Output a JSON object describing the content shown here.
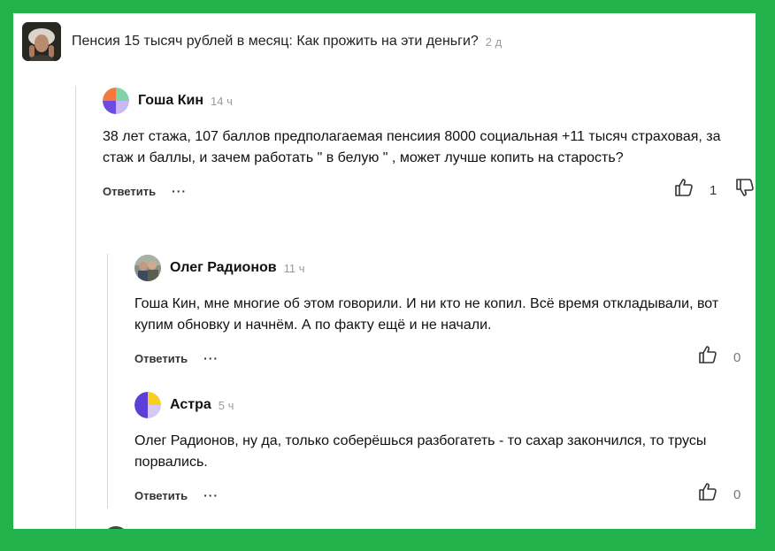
{
  "article": {
    "title": "Пенсия 15 тысяч рублей в месяц: Как прожить на эти деньги?",
    "time": "2 д"
  },
  "comments": [
    {
      "author": "Гоша Кин",
      "time": "14 ч",
      "text": "38 лет стажа, 107 баллов предполагаемая пенсиия 8000 социальная +11 тысяч страховая, за стаж и баллы, и зачем работать \" в белую \" , может лучше копить на старость?",
      "reply_label": "Ответить",
      "more_label": "···",
      "likes": "1"
    },
    {
      "author": "Олег Радионов",
      "time": "11 ч",
      "text": "Гоша Кин, мне многие об этом говорили. И ни кто не копил. Всё время откладывали, вот купим обновку и начнём. А по факту ещё и не начали.",
      "reply_label": "Ответить",
      "more_label": "···",
      "likes": "0"
    },
    {
      "author": "Астра",
      "time": "5 ч",
      "text": "Олег Радионов, ну да, только соберёшься разбогатеть - то сахар закончился, то трусы порвались.",
      "reply_label": "Ответить",
      "more_label": "···",
      "likes": "0"
    }
  ],
  "icons": {
    "like": "thumb-up-icon",
    "dislike": "thumb-down-icon"
  }
}
